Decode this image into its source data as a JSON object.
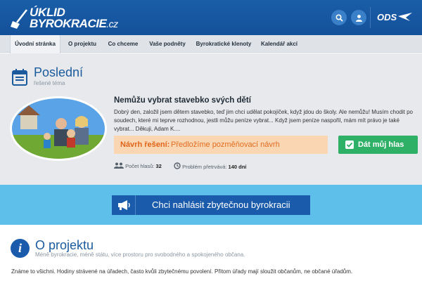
{
  "header": {
    "logo_line1": "ÚKLID",
    "logo_line2": "BYROKRACIE",
    "logo_tld": ".cz",
    "party": "ODS",
    "icons": [
      "search-icon",
      "user-icon"
    ],
    "colors": {
      "header_bg": "#14509a",
      "accent_button": "#3a80c8"
    }
  },
  "nav": {
    "items": [
      {
        "label": "Úvodní stránka",
        "active": true
      },
      {
        "label": "O projektu"
      },
      {
        "label": "Co chceme"
      },
      {
        "label": "Vaše podněty"
      },
      {
        "label": "Byrokratické klenoty"
      },
      {
        "label": "Kalendář akcí"
      }
    ]
  },
  "featured": {
    "title": "Poslední",
    "subtitle": "řešené téma",
    "story_title": "Nemůžu vybrat stavebko svých dětí",
    "story_text": "Dobrý den,    založil jsem dětem stavebko, teď jim chci udělat pokojíček, když jdou do školy. Ale nemůžu! Musím chodit po soudech, které mi teprve rozhodnou, jestli můžu peníze vybrat... Když jsem peníze naspořil, mám mít právo je také vybrat...   Děkuji, Adam K....",
    "proposal_label": "Návrh řešení:",
    "proposal_text": "Předložíme pozměňovací návrh",
    "vote_button": "Dát můj hlas",
    "votes_label": "Počet hlasů:",
    "votes_value": "32",
    "duration_label": "Problém přetrvává:",
    "duration_value": "140 dní",
    "colors": {
      "proposal_bg": "#fbd6b2",
      "proposal_text": "#e0641a",
      "vote_button": "#2fb067"
    }
  },
  "banner": {
    "report_button": "Chci nahlásit zbytečnou byrokracii",
    "icon": "megaphone-icon",
    "colors": {
      "banner_bg": "#5ec0ea",
      "button_bg": "#1a5cab"
    }
  },
  "about": {
    "title": "O projektu",
    "subtitle": "Méně byrokracie, méně státu, více prostoru pro svobodného a spokojeného občana.",
    "text": "Známe to všichni. Hodiny strávené na úřadech, často kvůli zbytečnému povolení. Přitom úřady mají sloužit občanům, ne občané úřadům.",
    "icon": "info-icon"
  }
}
